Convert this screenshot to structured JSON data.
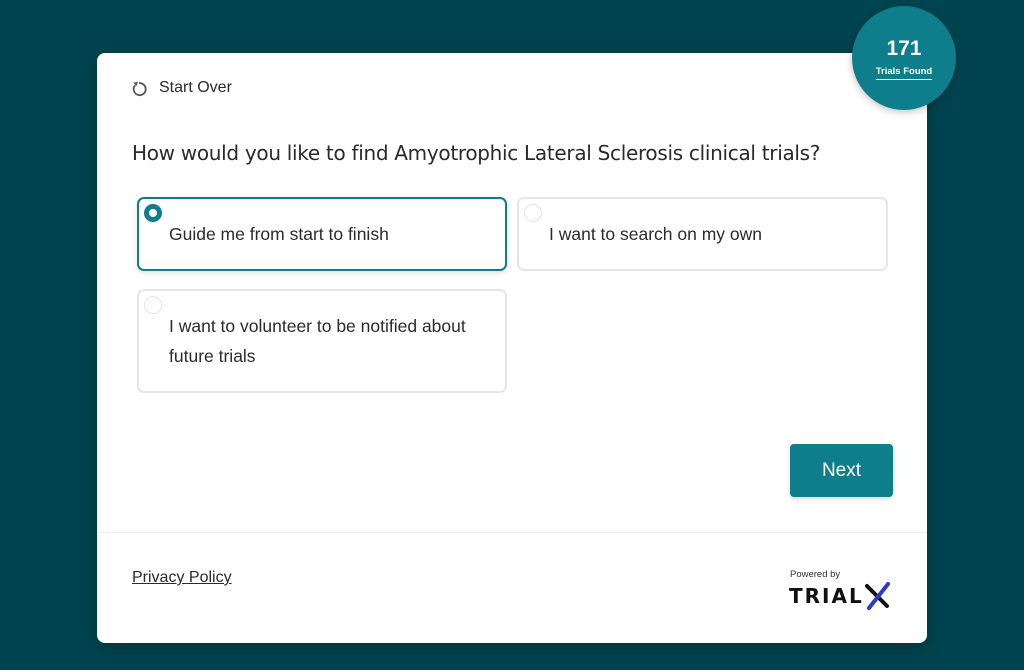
{
  "header": {
    "start_over_label": "Start Over"
  },
  "question": "How would you like to find Amyotrophic Lateral Sclerosis clinical trials?",
  "options": [
    {
      "label": "Guide me from start to finish",
      "selected": true
    },
    {
      "label": "I want to search on my own",
      "selected": false
    },
    {
      "label": "I want to volunteer to be notified about future trials",
      "selected": false
    }
  ],
  "next_label": "Next",
  "footer": {
    "privacy_label": "Privacy Policy",
    "powered_by": "Powered by",
    "brand": "TRIALX"
  },
  "badge": {
    "count": "171",
    "label": "Trials Found"
  },
  "colors": {
    "background": "#00444f",
    "accent": "#0e7d8c"
  },
  "icons": {
    "start_over": "refresh-icon",
    "brand_x": "trialx-x-icon"
  }
}
